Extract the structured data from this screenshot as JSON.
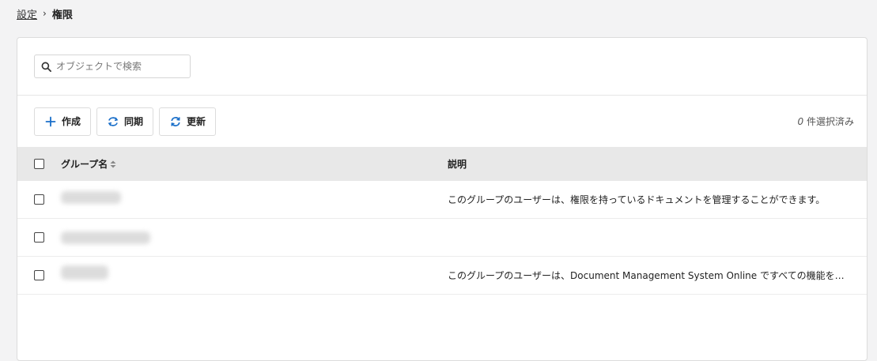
{
  "breadcrumb": {
    "parent": "設定",
    "separator": "›",
    "current": "権限"
  },
  "search": {
    "placeholder": "オブジェクトで検索",
    "icon": "search-icon"
  },
  "toolbar": {
    "create_label": "作成",
    "sync_label": "同期",
    "refresh_label": "更新",
    "selected_count": "0",
    "selected_suffix": " 件選択済み"
  },
  "table": {
    "headers": {
      "name": "グループ名",
      "description": "説明"
    },
    "rows": [
      {
        "name": "",
        "description": "このグループのユーザーは、権限を持っているドキュメントを管理することができます。"
      },
      {
        "name": "",
        "description": ""
      },
      {
        "name": "",
        "description": "このグループのユーザーは、Document Management System Online ですべての機能を使用できます。"
      }
    ]
  },
  "colors": {
    "accent": "#1a6fc9",
    "header_bg": "#e8e8e8",
    "page_bg": "#f3f3f4"
  }
}
